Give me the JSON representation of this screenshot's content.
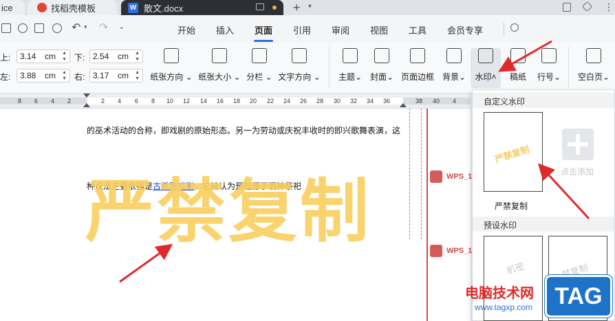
{
  "titlebar": {
    "first_tab": "ice",
    "daoke_tab": "找稻壳模板",
    "doc_tab": "散文.docx",
    "doc_icon_letter": "W"
  },
  "menu": {
    "tabs": [
      "开始",
      "插入",
      "页面",
      "引用",
      "审阅",
      "视图",
      "工具",
      "会员专享"
    ],
    "active": "页面"
  },
  "ribbon": {
    "margin_top_label": "上:",
    "margin_top_value": "3.14",
    "margin_bottom_label": "下:",
    "margin_bottom_value": "2.54",
    "margin_left_label": "左:",
    "margin_left_value": "3.88",
    "margin_right_label": "右:",
    "margin_right_value": "3.17",
    "unit": "cm",
    "paper_orientation": "纸张方向",
    "paper_size": "纸张大小",
    "columns": "分栏",
    "text_direction": "文字方向",
    "theme": "主题",
    "cover": "封面",
    "page_border": "页面边框",
    "background": "背景",
    "watermark": "水印",
    "manuscript": "稿纸",
    "line_number": "行号",
    "blank_page": "空白页"
  },
  "ruler": {
    "ticks": [
      "8",
      "6",
      "4",
      "2",
      "2",
      "4",
      "6",
      "8",
      "10",
      "12",
      "14",
      "16",
      "18",
      "20",
      "22",
      "24",
      "26",
      "28",
      "30",
      "32",
      "34",
      "36",
      "38",
      "40",
      "4"
    ]
  },
  "document": {
    "line1": "的巫术活动的合称，即戏剧的原始形态。另一为劳动或庆祝丰收时的即兴歌舞表演，这",
    "line2_before": "种说法主要依据是",
    "line2_link": "古希腊戏剧",
    "line2_after": "，它被认为是起源于酒神祭祀",
    "watermark_text": "严禁复制",
    "comment_author": "WPS_1"
  },
  "dropdown": {
    "custom_header": "自定义水印",
    "custom_card_text": "严禁复制",
    "custom_card_name": "严禁复制",
    "add_label": "点击添加",
    "preset_header": "预设水印",
    "preset_1_text": "机密",
    "preset_2_text": "禁复制"
  },
  "overlay": {
    "brand_text": "电脑技术网",
    "brand_url": "www.tagxp.com",
    "tag_text": "TAG"
  },
  "colors": {
    "accent": "#2f6ee6",
    "watermark_yellow": "#f9cf5f",
    "arrow_red": "#e02a2a",
    "comment_red": "#d24a4a"
  }
}
